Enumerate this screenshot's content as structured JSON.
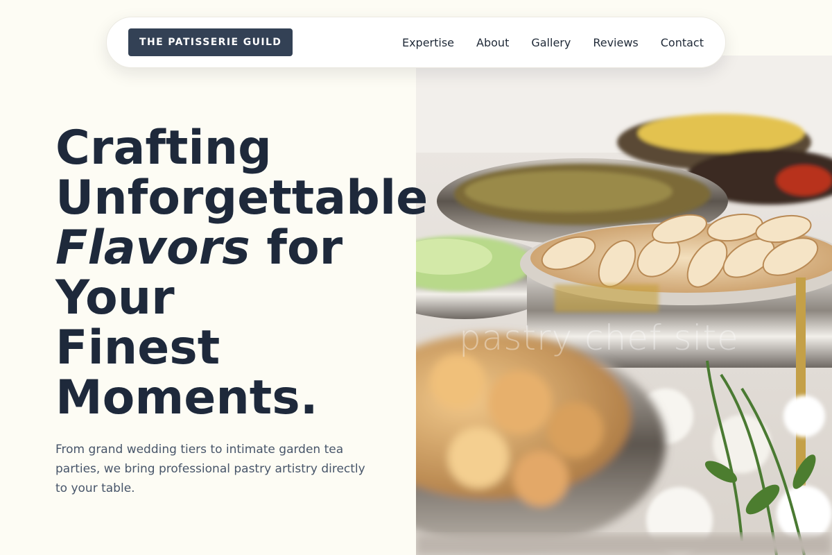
{
  "brand": {
    "name": "THE PATISSERIE GUILD"
  },
  "nav": {
    "links": [
      "Expertise",
      "About",
      "Gallery",
      "Reviews",
      "Contact"
    ]
  },
  "hero": {
    "title_line1": "Crafting",
    "title_line2": "Unforgettable",
    "title_emphasis": "Flavors",
    "title_line3_rest": " for",
    "title_line4": "Your",
    "title_line5": "Finest",
    "title_line6": "Moments.",
    "subtitle": "From grand wedding tiers to intimate garden tea parties, we bring professional pastry artistry directly to your table."
  },
  "image": {
    "watermark": "pastry chef site"
  },
  "colors": {
    "background": "#fdfcf4",
    "heading": "#1e293b",
    "brand_bg": "#334155",
    "body_text": "#475569"
  }
}
